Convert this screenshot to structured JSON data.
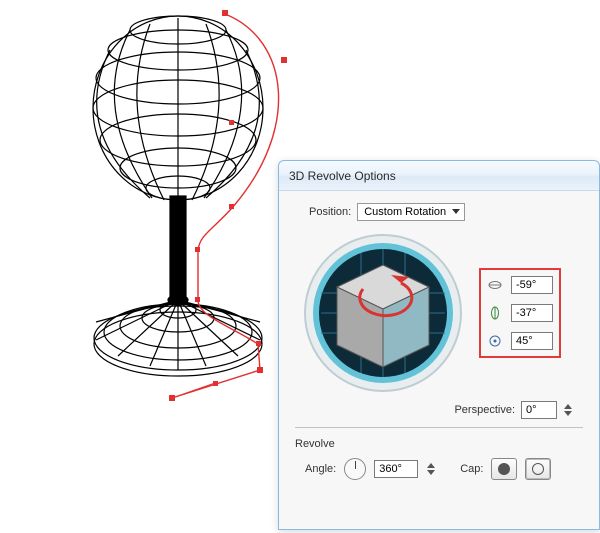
{
  "dialog": {
    "title": "3D Revolve Options",
    "position_label": "Position:",
    "position_value": "Custom Rotation",
    "rotation": {
      "x": "-59°",
      "y": "-37°",
      "z": "45°"
    },
    "perspective_label": "Perspective:",
    "perspective_value": "0°",
    "revolve_label": "Revolve",
    "angle_label": "Angle:",
    "angle_value": "360°",
    "cap_label": "Cap:"
  }
}
